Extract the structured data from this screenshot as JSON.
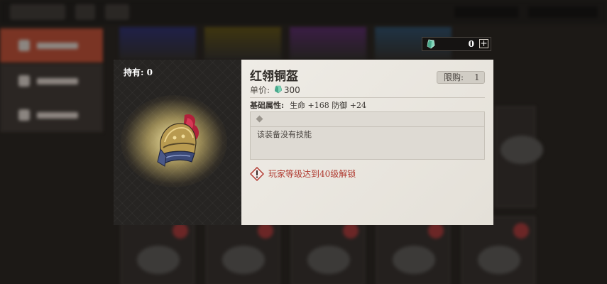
{
  "item": {
    "name": "红翎铜盔",
    "price_label": "单价:",
    "price": "300",
    "limit_label": "限购:",
    "limit_value": "1"
  },
  "holdings": {
    "label": "持有: 0"
  },
  "attributes": {
    "label": "基础属性:",
    "values": "生命 +168 防御 +24"
  },
  "skills": {
    "empty_text": "该装备没有技能"
  },
  "unlock": {
    "text": "玩家等级达到40级解锁"
  },
  "currency_counter": {
    "value": "0",
    "add_symbol": "+"
  },
  "colors": {
    "warning": "#b03a30",
    "gem": "#7fd4b8",
    "active_tab": "#7a3424"
  },
  "icons": {
    "currency": "green-gem-icon",
    "warning": "exclamation-diamond-icon",
    "add": "plus-icon"
  }
}
